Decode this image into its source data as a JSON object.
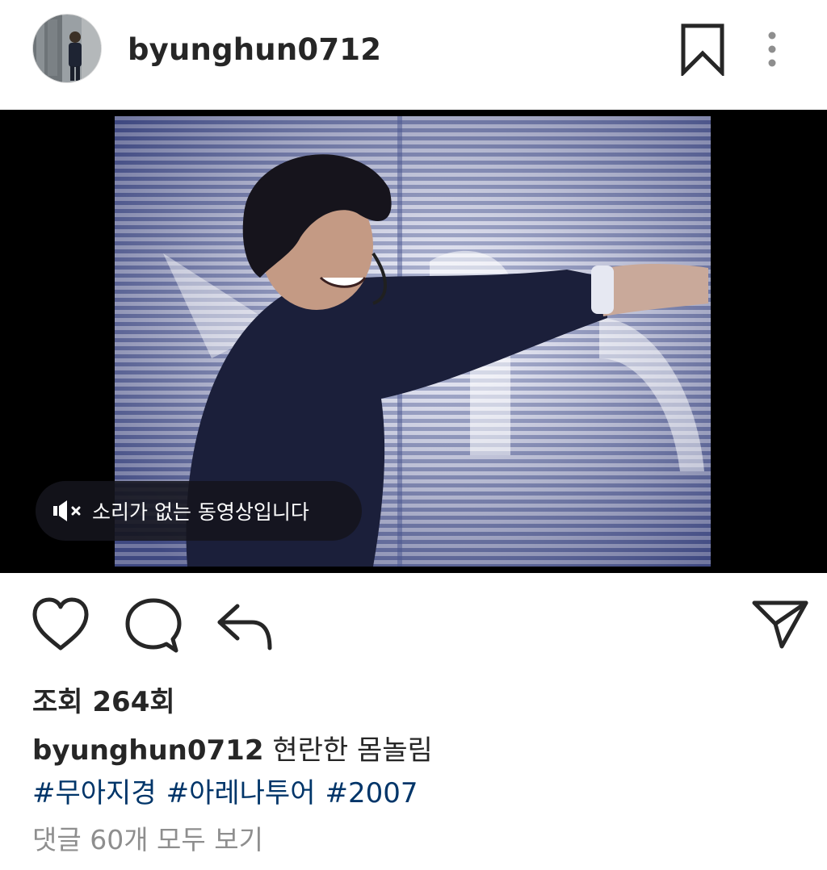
{
  "header": {
    "username": "byunghun0712"
  },
  "video": {
    "sound_notice": "소리가 없는 동영상입니다"
  },
  "stats": {
    "views": "조회 264회"
  },
  "caption": {
    "username": "byunghun0712",
    "text": "현란한 몸놀림"
  },
  "hashtags": [
    "#무아지경",
    "#아레나투어",
    "#2007"
  ],
  "comments": {
    "view_all": "댓글 60개 모두 보기"
  },
  "colors": {
    "hashtag": "#003569",
    "muted_text": "#8e8e8e",
    "primary_text": "#262626"
  },
  "icons": {
    "header": [
      "bookmark-icon",
      "more-vertical-icon"
    ],
    "actions": [
      "heart-icon",
      "comment-icon",
      "reply-icon",
      "share-send-icon"
    ],
    "video": [
      "sound-off-icon"
    ]
  }
}
